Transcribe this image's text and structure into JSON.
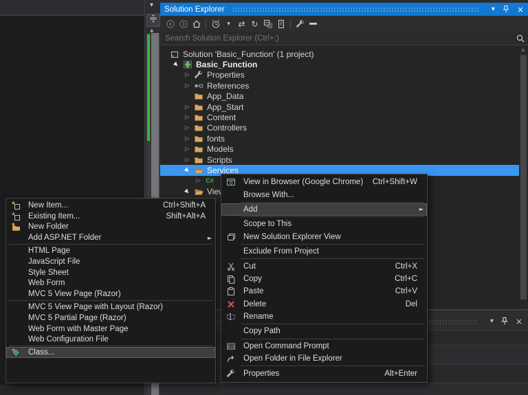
{
  "colors": {
    "titlebar_active_blue": "#1278D2",
    "selection_blue": "#3B95F2",
    "panel_background": "#2D2D30",
    "tree_background": "#252526",
    "menu_background": "#1B1B1C",
    "menu_highlight": "#3E3E41",
    "folder_tan": "#D8A75F",
    "delete_red": "#E0534E",
    "change_marker_green": "#3CB53C",
    "csharp_green": "#3FB53F"
  },
  "editor": {
    "scrollbar_icons": [
      "scroll-menu-caret",
      "splitter-handle",
      "scroll-up"
    ],
    "has_change_marker": true
  },
  "solution_explorer": {
    "title": "Solution Explorer",
    "window_buttons": [
      "window-position",
      "pin",
      "close"
    ],
    "toolbar": [
      "back",
      "forward",
      "home",
      "separator",
      "pending-filter",
      "caret-down",
      "sync",
      "refresh",
      "collapse-all",
      "preview",
      "separator",
      "wrench",
      "show-all-files"
    ],
    "search_placeholder": "Search Solution Explorer (Ctrl+;)",
    "tree": [
      {
        "label": "Solution 'Basic_Function' (1 project)",
        "level": 0,
        "icon": "solution",
        "arrow": "none"
      },
      {
        "label": "Basic_Function",
        "level": 1,
        "icon": "project",
        "arrow": "expanded",
        "bold": true
      },
      {
        "label": "Properties",
        "level": 2,
        "icon": "wrench",
        "arrow": "collapsed"
      },
      {
        "label": "References",
        "level": 2,
        "icon": "references",
        "arrow": "collapsed"
      },
      {
        "label": "App_Data",
        "level": 2,
        "icon": "folder",
        "arrow": "none"
      },
      {
        "label": "App_Start",
        "level": 2,
        "icon": "folder",
        "arrow": "collapsed"
      },
      {
        "label": "Content",
        "level": 2,
        "icon": "folder",
        "arrow": "collapsed"
      },
      {
        "label": "Controllers",
        "level": 2,
        "icon": "folder",
        "arrow": "collapsed"
      },
      {
        "label": "fonts",
        "level": 2,
        "icon": "folder",
        "arrow": "collapsed"
      },
      {
        "label": "Models",
        "level": 2,
        "icon": "folder",
        "arrow": "collapsed"
      },
      {
        "label": "Scripts",
        "level": 2,
        "icon": "folder",
        "arrow": "collapsed"
      },
      {
        "label": "Services",
        "level": 2,
        "icon": "folder-open",
        "arrow": "expanded",
        "selected": true
      },
      {
        "label": "",
        "level": 3,
        "icon": "csharp",
        "arrow": "collapsed"
      },
      {
        "label": "Views",
        "level": 2,
        "icon": "folder-open",
        "arrow": "expanded"
      }
    ]
  },
  "context_menu": {
    "items": [
      {
        "label": "View in Browser (Google Chrome)",
        "shortcut": "Ctrl+Shift+W",
        "icon": "browser"
      },
      {
        "label": "Browse With..."
      },
      {
        "type": "separator"
      },
      {
        "label": "Add",
        "submenu": true,
        "highlighted": true
      },
      {
        "type": "separator"
      },
      {
        "label": "Scope to This"
      },
      {
        "label": "New Solution Explorer View",
        "icon": "new-solution-view"
      },
      {
        "type": "separator"
      },
      {
        "label": "Exclude From Project"
      },
      {
        "type": "separator"
      },
      {
        "label": "Cut",
        "shortcut": "Ctrl+X",
        "icon": "cut"
      },
      {
        "label": "Copy",
        "shortcut": "Ctrl+C",
        "icon": "copy"
      },
      {
        "label": "Paste",
        "shortcut": "Ctrl+V",
        "icon": "paste"
      },
      {
        "label": "Delete",
        "shortcut": "Del",
        "icon": "delete"
      },
      {
        "label": "Rename",
        "icon": "rename"
      },
      {
        "type": "separator"
      },
      {
        "label": "Copy Path"
      },
      {
        "type": "separator"
      },
      {
        "label": "Open Command Prompt",
        "icon": "cmd"
      },
      {
        "label": "Open Folder in File Explorer",
        "icon": "open-explorer"
      },
      {
        "type": "separator"
      },
      {
        "label": "Properties",
        "shortcut": "Alt+Enter",
        "icon": "wrench"
      }
    ]
  },
  "add_submenu": {
    "items": [
      {
        "label": "New Item...",
        "shortcut": "Ctrl+Shift+A",
        "icon": "new-item"
      },
      {
        "label": "Existing Item...",
        "shortcut": "Shift+Alt+A",
        "icon": "existing-item"
      },
      {
        "label": "New Folder",
        "icon": "new-folder"
      },
      {
        "label": "Add ASP.NET Folder",
        "submenu": true
      },
      {
        "type": "separator"
      },
      {
        "label": "HTML Page"
      },
      {
        "label": "JavaScript File"
      },
      {
        "label": "Style Sheet"
      },
      {
        "label": "Web Form"
      },
      {
        "label": "MVC 5 View Page (Razor)"
      },
      {
        "type": "separator"
      },
      {
        "label": "MVC 5 View Page with Layout (Razor)"
      },
      {
        "label": "MVC 5 Partial Page (Razor)"
      },
      {
        "label": "Web Form with Master Page"
      },
      {
        "label": "Web Configuration File"
      },
      {
        "type": "separator"
      },
      {
        "label": "Class...",
        "icon": "class",
        "highlighted": true
      }
    ]
  },
  "lower_panel": {
    "window_buttons": [
      "window-position",
      "pin",
      "close"
    ]
  }
}
